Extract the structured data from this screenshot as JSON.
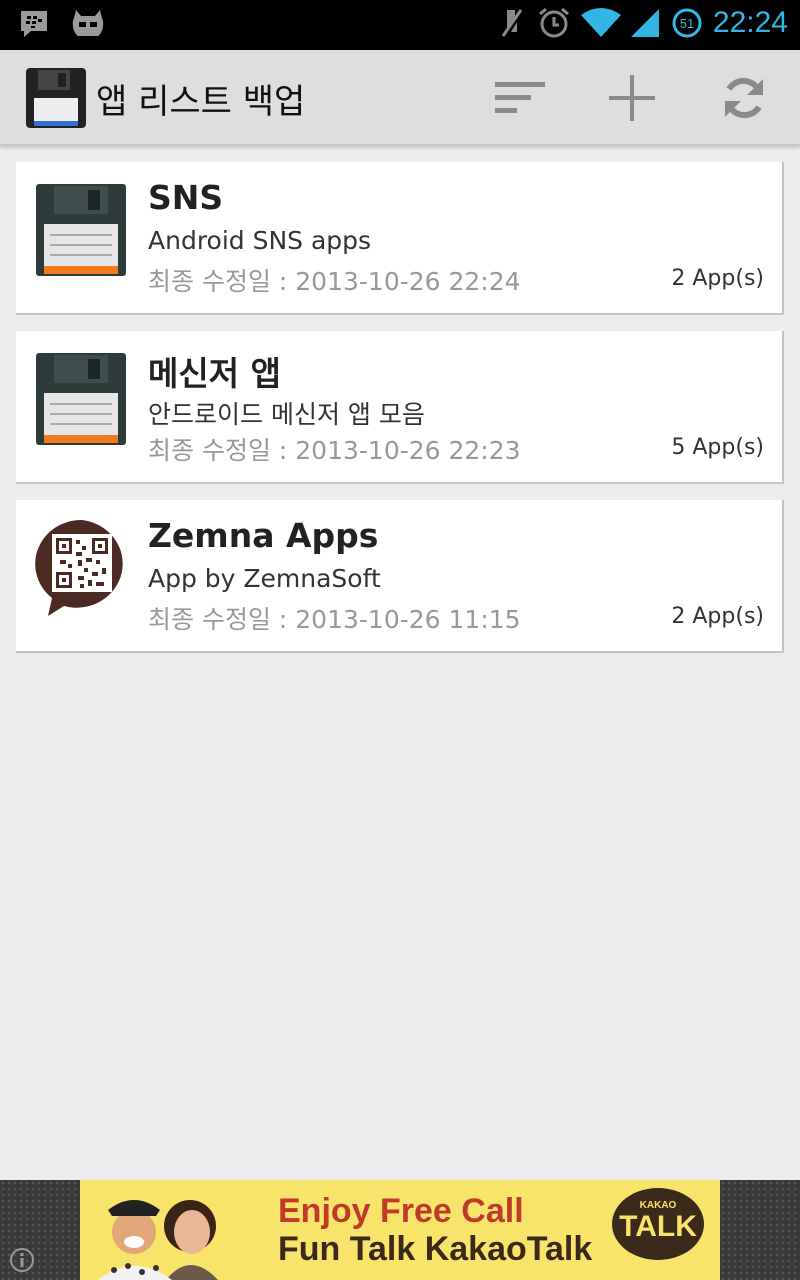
{
  "status_bar": {
    "time": "22:24",
    "battery_level": "51",
    "icons": [
      "bbm-notification-icon",
      "cyanogen-icon",
      "mute-icon",
      "alarm-icon",
      "wifi-icon",
      "signal-icon",
      "battery-icon"
    ]
  },
  "action_bar": {
    "title": "앱 리스트 백업",
    "actions": [
      "sort-icon",
      "add-icon",
      "refresh-icon"
    ]
  },
  "lists": [
    {
      "title": "SNS",
      "description": "Android SNS apps",
      "modified": "최종 수정일 : 2013-10-26 22:24",
      "count": "2 App(s)",
      "icon": "floppy-disk-icon"
    },
    {
      "title": "메신저 앱",
      "description": "안드로이드 메신저 앱 모음",
      "modified": "최종 수정일 : 2013-10-26 22:23",
      "count": "5 App(s)",
      "icon": "floppy-disk-icon"
    },
    {
      "title": "Zemna Apps",
      "description": "App by ZemnaSoft",
      "modified": "최종 수정일 : 2013-10-26 11:15",
      "count": "2 App(s)",
      "icon": "qr-code-bubble-icon"
    }
  ],
  "ad": {
    "line1": "Enjoy Free Call",
    "line2": "Fun Talk KakaoTalk",
    "logo_top": "KAKAO",
    "logo_main": "TALK"
  },
  "colors": {
    "accent": "#33b5e5",
    "ad_background": "#f8e46b"
  }
}
